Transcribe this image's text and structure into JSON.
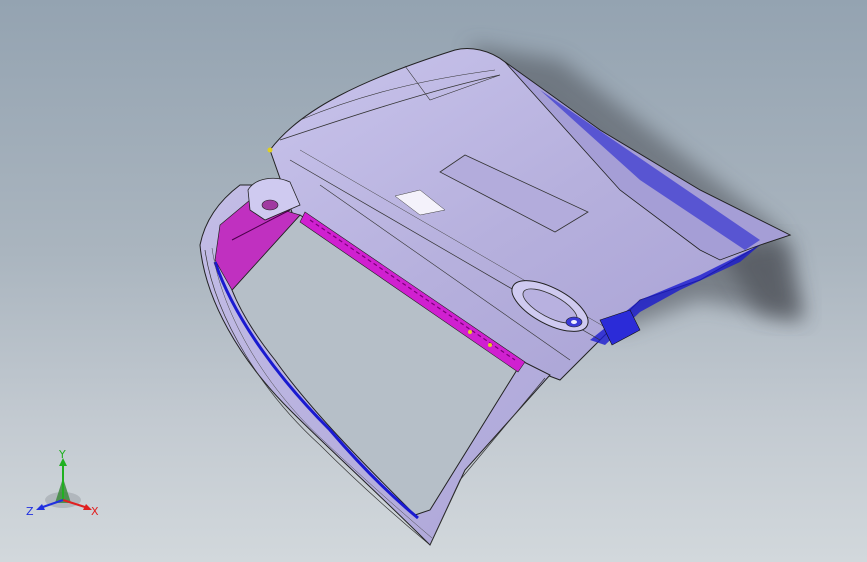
{
  "viewport": {
    "background_top": "#94a3b1",
    "background_bottom": "#d2d8dc",
    "model": {
      "name": "trunk-lid-assembly",
      "body_color": "#b9b3e0",
      "shadow_color": "#4b4f57",
      "inner_frame_color": "#d020d0",
      "blue_edge_color": "#1a1ad0"
    }
  },
  "triad": {
    "x_label": "X",
    "y_label": "Y",
    "z_label": "Z",
    "x_color": "#e02020",
    "y_color": "#20b020",
    "z_color": "#2030e0"
  }
}
